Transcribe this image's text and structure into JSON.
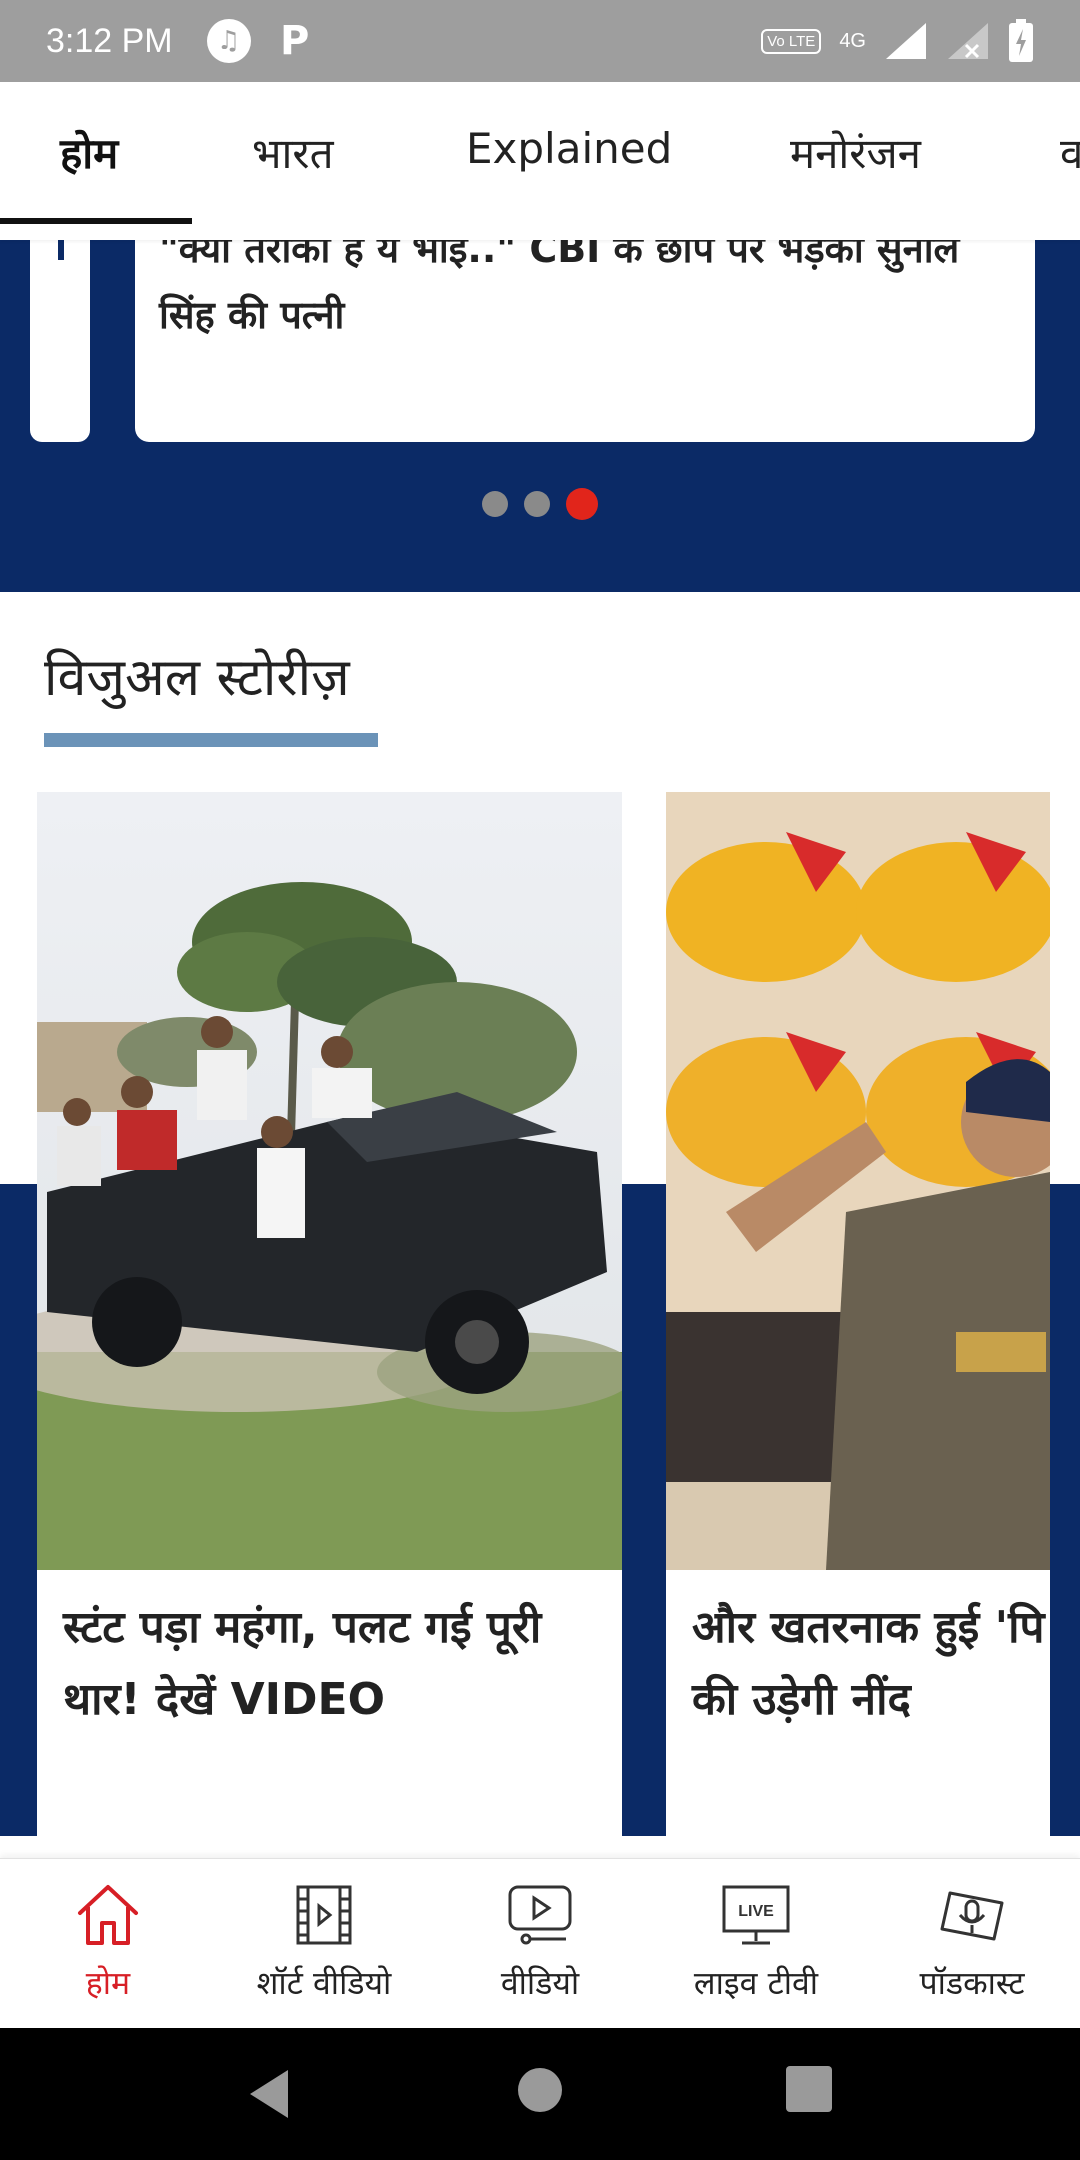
{
  "status_bar": {
    "time": "3:12 PM",
    "network_label": "4G",
    "volte_label": "Vo LTE",
    "app_icons": [
      "music-icon",
      "p-icon"
    ],
    "p_glyph": "P"
  },
  "tabs": [
    {
      "label": "होम",
      "active": true
    },
    {
      "label": "भारत",
      "active": false
    },
    {
      "label": "Explained",
      "active": false
    },
    {
      "label": "मनोरंजन",
      "active": false
    },
    {
      "label": "व",
      "active": false
    }
  ],
  "top_news": {
    "headline": "\"क्या तरीका है ये भाई..\" CBI के छापे पर भड़की सुनील सिंह की पत्नी",
    "carousel": {
      "count": 3,
      "active_index": 2
    }
  },
  "visual_stories": {
    "title": "विजुअल स्टोरीज़",
    "items": [
      {
        "caption": "स्टंट पड़ा महंगा, पलट गई पूरी थार! देखें VIDEO"
      },
      {
        "caption": "और खतरनाक हुई 'पि दुश्मनों की उड़ेगी नींद"
      }
    ]
  },
  "bottom_nav": [
    {
      "label": "होम",
      "icon": "home-icon",
      "active": true
    },
    {
      "label": "शॉर्ट वीडियो",
      "icon": "film-strip-icon",
      "active": false
    },
    {
      "label": "वीडियो",
      "icon": "video-play-icon",
      "active": false
    },
    {
      "label": "लाइव टीवी",
      "icon": "live-tv-icon",
      "active": false,
      "badge": "LIVE"
    },
    {
      "label": "पॉडकास्ट",
      "icon": "podcast-icon",
      "active": false
    }
  ],
  "colors": {
    "brand_navy": "#0b2a66",
    "accent_red": "#e1251b",
    "nav_active": "#d71f26",
    "section_underline": "#6b93b8"
  }
}
